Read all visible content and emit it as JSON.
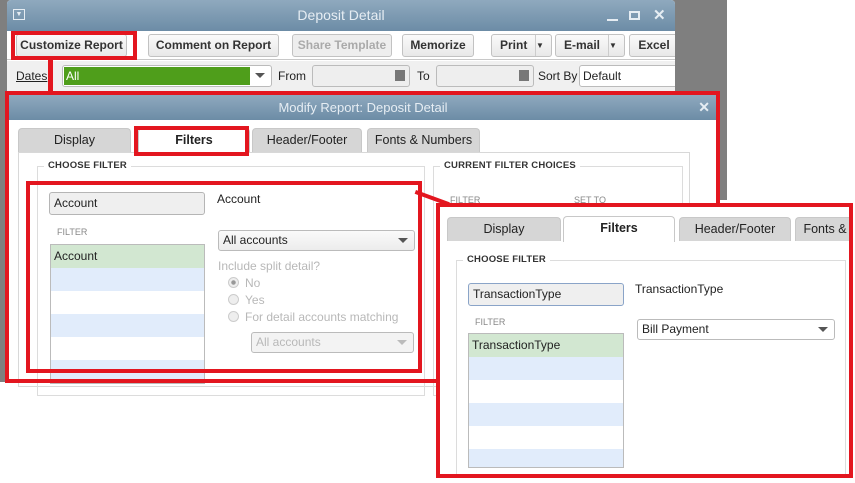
{
  "window": {
    "title": "Deposit Detail"
  },
  "toolbar": {
    "customize": "Customize Report",
    "comment": "Comment on Report",
    "share": "Share Template",
    "memorize": "Memorize",
    "print": "Print",
    "email": "E-mail",
    "excel": "Excel"
  },
  "dates": {
    "label": "Dates",
    "value": "All",
    "from_label": "From",
    "from_value": "",
    "to_label": "To",
    "to_value": "",
    "sort_label": "Sort By",
    "sort_value": "Default"
  },
  "dialog": {
    "title": "Modify Report: Deposit Detail",
    "tabs": [
      "Display",
      "Filters",
      "Header/Footer",
      "Fonts & Numbers"
    ],
    "choose_filter": "CHOOSE FILTER",
    "search_value": "Account",
    "filter_header": "FILTER",
    "filters": [
      "Account"
    ],
    "selected_name": "Account",
    "account_select": "All accounts",
    "split_label": "Include split detail?",
    "radios": [
      "No",
      "Yes",
      "For detail accounts matching"
    ],
    "detail_select": "All accounts",
    "current_filter_choices": "CURRENT FILTER CHOICES",
    "cur_col_filter": "FILTER",
    "cur_col_set_to": "SET TO"
  },
  "zoom_panel": {
    "tabs": [
      "Display",
      "Filters",
      "Header/Footer",
      "Fonts &"
    ],
    "choose_filter": "CHOOSE FILTER",
    "search_value": "TransactionType",
    "filter_header": "FILTER",
    "filters": [
      "TransactionType"
    ],
    "selected_name": "TransactionType",
    "type_select": "Bill Payment"
  },
  "colors": {
    "highlight": "#e3161f",
    "dates_green": "#4f9e1b",
    "titlebar": "#7d9ab1"
  }
}
